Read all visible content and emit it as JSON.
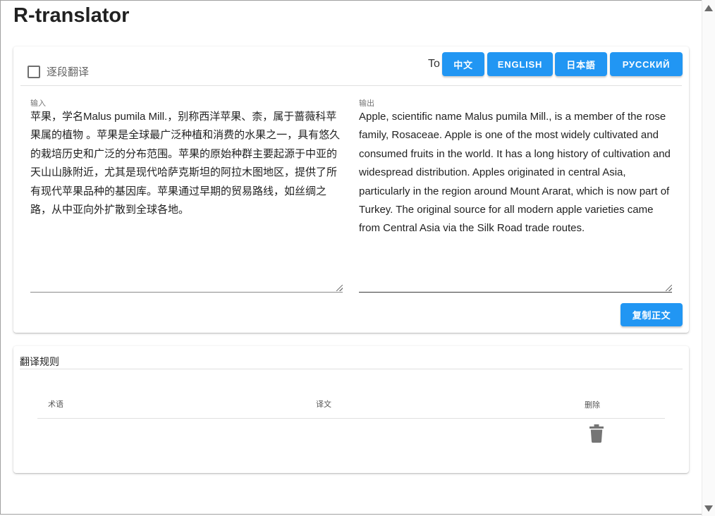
{
  "app": {
    "title": "R-translator"
  },
  "toolbar": {
    "paragraph_toggle_label": "逐段翻译",
    "paragraph_toggle_checked": false,
    "to_label": "To",
    "languages": [
      {
        "label": "中文"
      },
      {
        "label": "ENGLISH"
      },
      {
        "label": "日本語"
      },
      {
        "label": "РУССКИЙ"
      }
    ]
  },
  "input": {
    "label": "输入",
    "text": "苹果，学名Malus pumila Mill.，别称西洋苹果、柰，属于蔷薇科苹果属的植物 。苹果是全球最广泛种植和消费的水果之一，具有悠久的栽培历史和广泛的分布范围。苹果的原始种群主要起源于中亚的天山山脉附近，尤其是现代哈萨克斯坦的阿拉木图地区，提供了所有现代苹果品种的基因库。苹果通过早期的贸易路线，如丝绸之路，从中亚向外扩散到全球各地。"
  },
  "output": {
    "label": "输出",
    "text": "Apple, scientific name Malus pumila Mill., is a member of the rose family, Rosaceae. Apple is one of the most widely cultivated and consumed fruits in the world. It has a long history of cultivation and widespread distribution. Apples originated in central Asia, particularly in the region around Mount Ararat, which is now part of Turkey. The original source for all modern apple varieties came from Central Asia via the Silk Road trade routes."
  },
  "copy_button_label": "复制正文",
  "rules": {
    "title": "翻译规则",
    "columns": {
      "term": "术语",
      "translation": "译文",
      "delete": "删除"
    },
    "rows": [
      {
        "term": "",
        "translation": ""
      }
    ]
  },
  "colors": {
    "accent": "#2196f3",
    "icon_gray": "#757575"
  }
}
